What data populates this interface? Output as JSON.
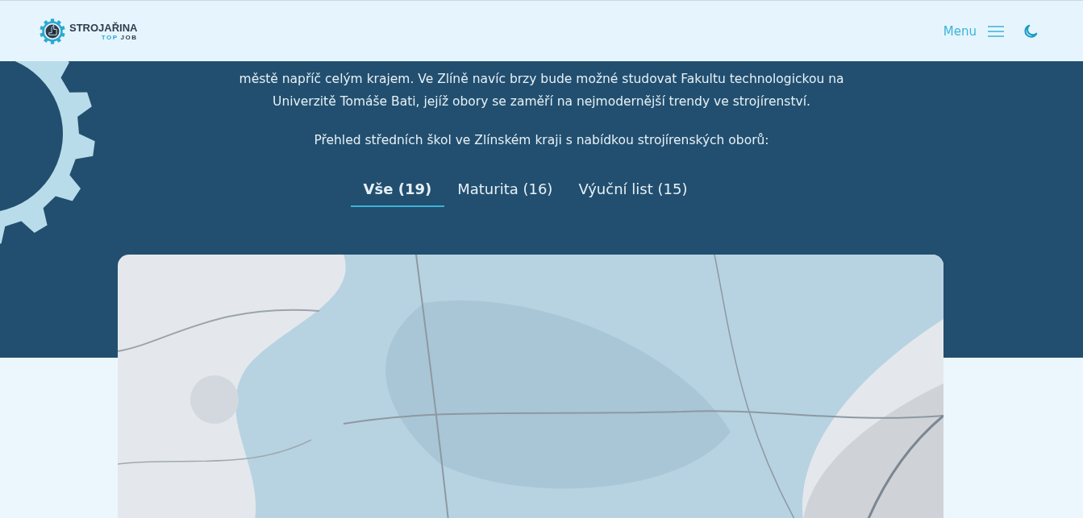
{
  "header": {
    "logo": {
      "name": "STROJAŘINA",
      "tagline_top": "TOP",
      "tagline_job": "JOB"
    },
    "menu_label": "Menu"
  },
  "intro": {
    "paragraph": "městě napříč celým krajem. Ve Zlíně navíc brzy bude možné studovat Fakultu technologickou na Univerzitě Tomáše Bati, jejíž obory se zaměří na nejmodernější trendy ve strojírenství.",
    "overview": "Přehled středních škol ve Zlínském kraji s nabídkou strojírenských oborů:"
  },
  "tabs": [
    {
      "label": "Vše (19)",
      "selected": true
    },
    {
      "label": "Maturita (16)",
      "selected": false
    },
    {
      "label": "Výuční list (15)",
      "selected": false
    }
  ]
}
